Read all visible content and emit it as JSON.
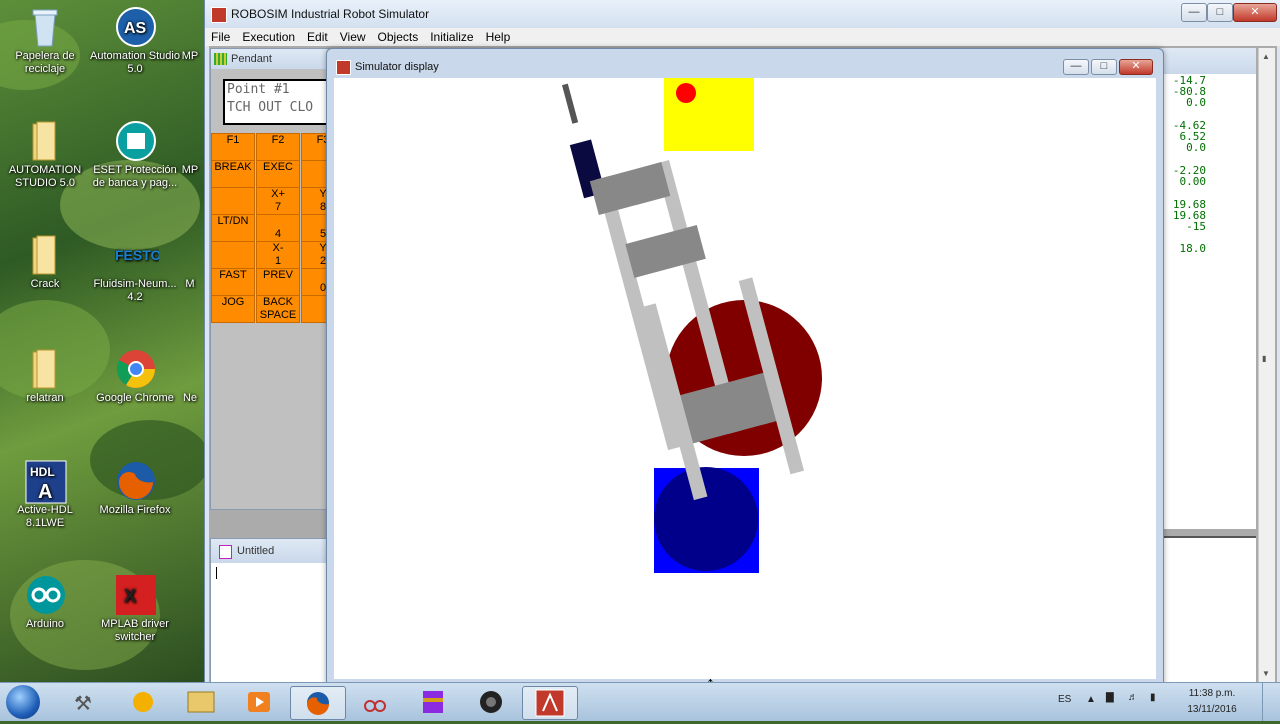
{
  "desktop": {
    "icons": [
      {
        "label": "Papelera de reciclaje",
        "icon": "recycle-bin-icon"
      },
      {
        "label": "Automation Studio 5.0",
        "icon": "automation-studio-icon"
      },
      {
        "label": "MP",
        "icon": "mplab-icon"
      },
      {
        "label": "AUTOMATION STUDIO 5.0",
        "icon": "folder-icon"
      },
      {
        "label": "ESET Protección de banca y pag...",
        "icon": "eset-icon"
      },
      {
        "label": "MP",
        "icon": "mplab-icon"
      },
      {
        "label": "Crack",
        "icon": "folder-icon"
      },
      {
        "label": "Fluidsim-Neum... 4.2",
        "icon": "festo-icon"
      },
      {
        "label": "M",
        "icon": "app-icon"
      },
      {
        "label": "relatran",
        "icon": "folder-icon"
      },
      {
        "label": "Google Chrome",
        "icon": "chrome-icon"
      },
      {
        "label": "Ne",
        "icon": "app-icon"
      },
      {
        "label": "Active-HDL 8.1LWE",
        "icon": "hdl-icon"
      },
      {
        "label": "Mozilla Firefox",
        "icon": "firefox-icon"
      },
      {
        "label": "Arduino",
        "icon": "arduino-icon"
      },
      {
        "label": "MPLAB driver switcher",
        "icon": "mplab-driver-icon"
      }
    ]
  },
  "main_window": {
    "title": "ROBOSIM Industrial Robot Simulator",
    "menu": [
      "File",
      "Execution",
      "Edit",
      "View",
      "Objects",
      "Initialize",
      "Help"
    ]
  },
  "pendant": {
    "title": "Pendant",
    "lcd_line1": "Point #1",
    "lcd_line2": "TCH OUT CLO",
    "keys": [
      "F1",
      "F2",
      "F3",
      "BREAK",
      "EXEC",
      "",
      "",
      "X+\n7",
      "Y\n8",
      "LT/DN",
      "4",
      "5",
      "",
      "X-\n1",
      "Y\n2",
      "FAST",
      "PREV",
      "0",
      "JOG",
      "BACK\nSPACE",
      ""
    ]
  },
  "simulator": {
    "title": "Simulator display"
  },
  "readout": {
    "lines": [
      "-14.7",
      "-80.8",
      "0.0",
      "-4.62",
      "6.52",
      "0.0",
      "-2.20",
      "0.00",
      "19.68",
      "19.68",
      "-15",
      "18.0"
    ]
  },
  "untitled": {
    "title": "Untitled"
  },
  "taskbar": {
    "language": "ES",
    "time": "11:38 p.m.",
    "date": "13/11/2016"
  }
}
